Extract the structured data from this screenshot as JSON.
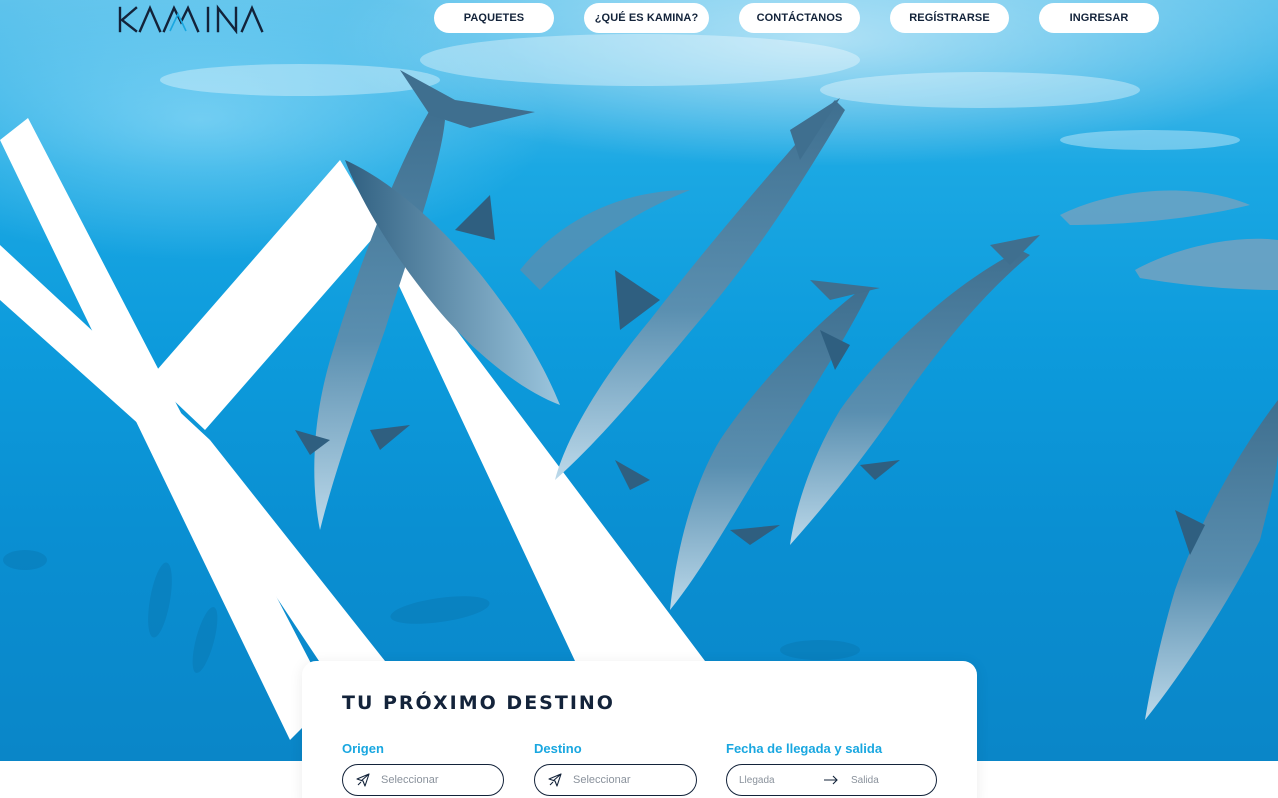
{
  "brand": {
    "logo_text": "KAMINA"
  },
  "nav": {
    "items": [
      {
        "label": "PAQUETES"
      },
      {
        "label": "¿QUÉ ES KAMINA?"
      },
      {
        "label": "CONTÁCTANOS"
      },
      {
        "label": "REGÍSTRARSE"
      },
      {
        "label": "INGRESAR"
      }
    ]
  },
  "hero": {
    "image": "underwater-dolphins"
  },
  "search": {
    "title": "TU PRÓXIMO DESTINO",
    "origin": {
      "label": "Origen",
      "placeholder": "Seleccionar",
      "icon": "plane-icon"
    },
    "destination": {
      "label": "Destino",
      "placeholder": "Seleccionar",
      "icon": "plane-icon"
    },
    "dates": {
      "label": "Fecha de llegada y salida",
      "arrival": "Llegada",
      "departure": "Salida",
      "icon": "arrow-right-icon"
    }
  },
  "colors": {
    "accent": "#19a7e0",
    "navy": "#13233a",
    "ocean": "#0d9bdc"
  }
}
